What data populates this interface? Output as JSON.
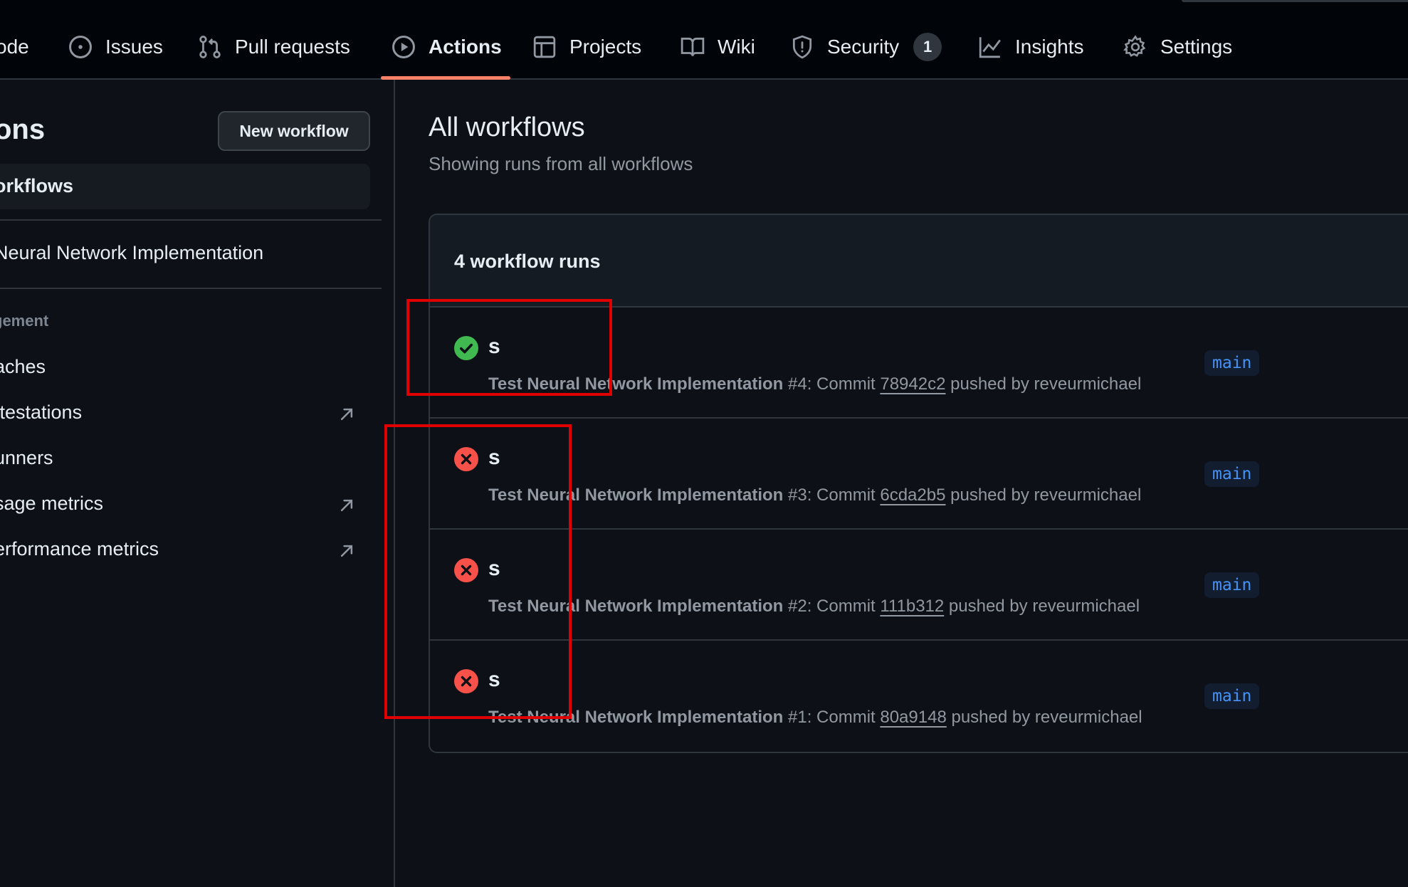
{
  "nav": {
    "tabs": [
      {
        "label": "ode",
        "icon": "code-icon"
      },
      {
        "label": "Issues",
        "icon": "issue-opened-icon"
      },
      {
        "label": "Pull requests",
        "icon": "git-pull-request-icon"
      },
      {
        "label": "Actions",
        "icon": "play-icon",
        "active": true
      },
      {
        "label": "Projects",
        "icon": "table-icon"
      },
      {
        "label": "Wiki",
        "icon": "book-icon"
      },
      {
        "label": "Security",
        "icon": "shield-icon",
        "counter": "1"
      },
      {
        "label": "Insights",
        "icon": "graph-icon"
      },
      {
        "label": "Settings",
        "icon": "gear-icon"
      }
    ],
    "active_color": "#f78166"
  },
  "sidebar": {
    "title": "ons",
    "new_workflow_label": "New workflow",
    "selected_item": "orkflows",
    "workflow_item": "Neural Network Implementation",
    "management_heading": "gement",
    "management_items": [
      {
        "label": "aches",
        "external": false
      },
      {
        "label": "ttestations",
        "external": true
      },
      {
        "label": "unners",
        "external": false
      },
      {
        "label": "sage metrics",
        "external": true
      },
      {
        "label": "erformance metrics",
        "external": true
      }
    ]
  },
  "main": {
    "title": "All workflows",
    "subtitle": "Showing runs from all workflows",
    "runs_count_label": "4 workflow runs",
    "runs": [
      {
        "status": "success",
        "title": "s",
        "workflow": "Test Neural Network Implementation",
        "run_number": "#4",
        "commit_prefix": ": Commit ",
        "sha": "78942c2",
        "pushed_by": " pushed by reveurmichael",
        "branch": "main"
      },
      {
        "status": "failure",
        "title": "s",
        "workflow": "Test Neural Network Implementation",
        "run_number": "#3",
        "commit_prefix": ": Commit ",
        "sha": "6cda2b5",
        "pushed_by": " pushed by reveurmichael",
        "branch": "main"
      },
      {
        "status": "failure",
        "title": "s",
        "workflow": "Test Neural Network Implementation",
        "run_number": "#2",
        "commit_prefix": ": Commit ",
        "sha": "111b312",
        "pushed_by": " pushed by reveurmichael",
        "branch": "main"
      },
      {
        "status": "failure",
        "title": "s",
        "workflow": "Test Neural Network Implementation",
        "run_number": "#1",
        "commit_prefix": ": Commit ",
        "sha": "80a9148",
        "pushed_by": " pushed by reveurmichael",
        "branch": "main"
      }
    ]
  },
  "colors": {
    "success": "#3fb950",
    "failure": "#f85149",
    "highlight_box": "#e00000"
  }
}
